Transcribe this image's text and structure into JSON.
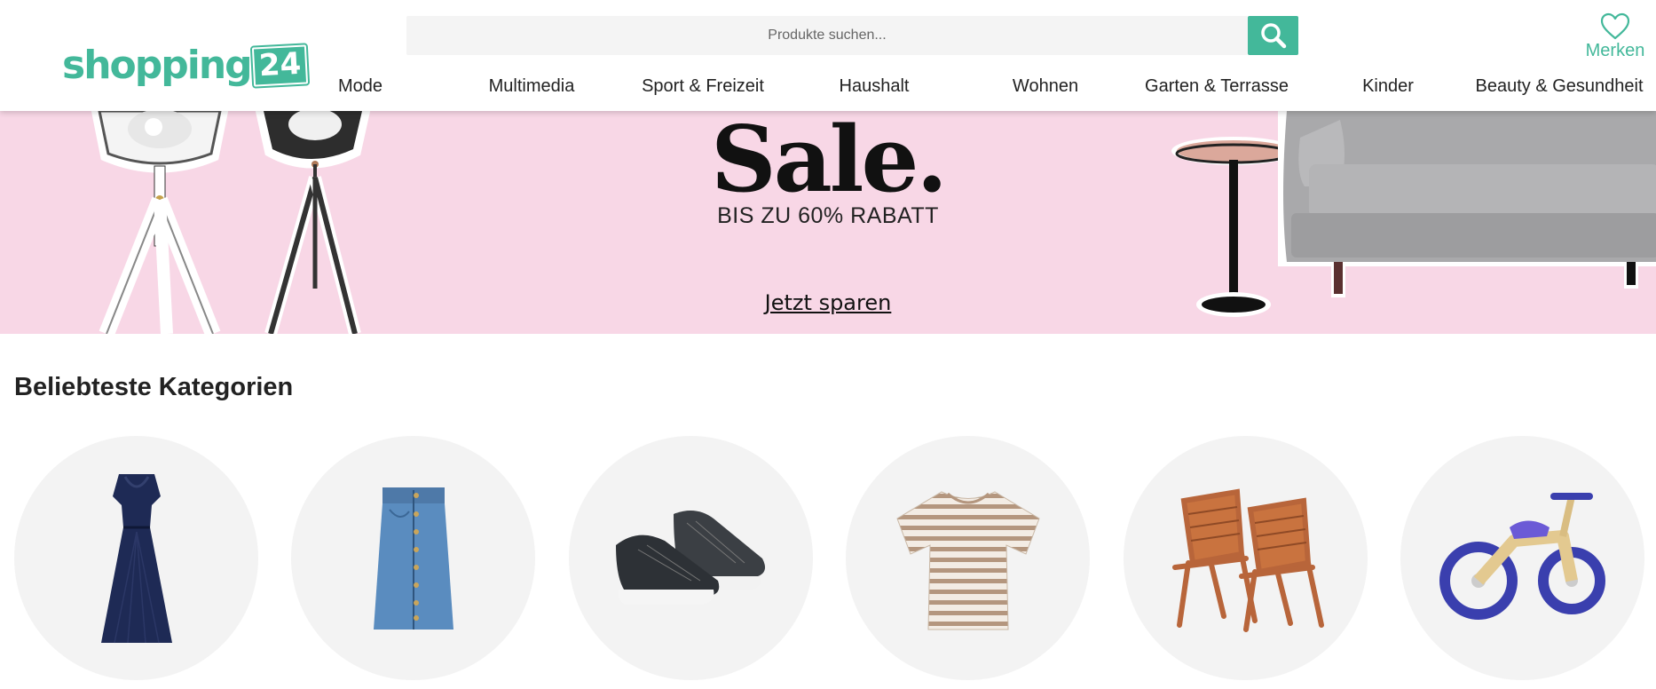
{
  "header": {
    "logo": {
      "text": "shopping",
      "badge": "24"
    },
    "search": {
      "placeholder": "Produkte suchen..."
    },
    "search_button_icon": "search-icon",
    "wishlist": {
      "label": "Merken",
      "icon": "heart-icon"
    },
    "nav": [
      "Mode",
      "Multimedia",
      "Sport & Freizeit",
      "Haushalt",
      "Wohnen",
      "Garten & Terrasse",
      "Kinder",
      "Beauty & Gesundheit"
    ]
  },
  "banner": {
    "title": "Sale.",
    "subtitle": "BIS ZU 60% RABATT",
    "cta": "Jetzt sparen",
    "background_color": "#f8d7e6"
  },
  "categories": {
    "title": "Beliebteste Kategorien",
    "items": [
      {
        "icon": "dress-icon"
      },
      {
        "icon": "denim-skirt-icon"
      },
      {
        "icon": "sneaker-icon"
      },
      {
        "icon": "striped-tshirt-icon"
      },
      {
        "icon": "garden-chairs-icon"
      },
      {
        "icon": "balance-bike-icon"
      }
    ]
  },
  "colors": {
    "accent": "#43b89a",
    "text": "#222222"
  }
}
